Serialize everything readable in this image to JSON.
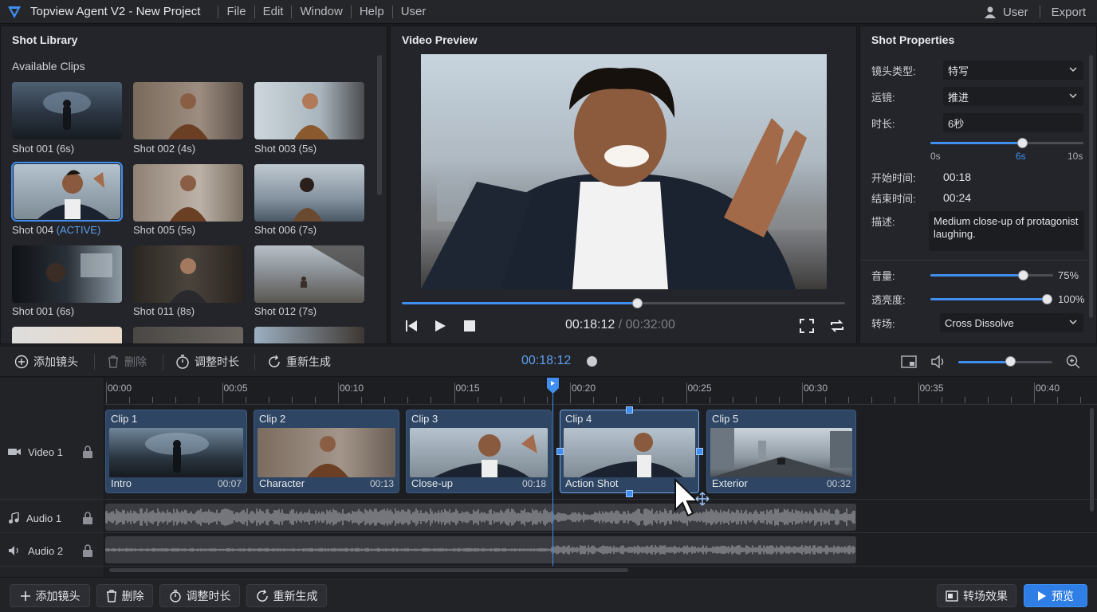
{
  "app": {
    "title": "Topview Agent V2 - New Project"
  },
  "menu": [
    "File",
    "Edit",
    "Window",
    "Help",
    "User"
  ],
  "menu_right": {
    "user": "User",
    "export": "Export"
  },
  "library": {
    "title": "Shot Library",
    "subtitle": "Available Clips",
    "clips": [
      {
        "name": "Shot 001 (6s)"
      },
      {
        "name": "Shot 002 (4s)"
      },
      {
        "name": "Shot 003 (5s)"
      },
      {
        "name": "Shot 004",
        "badge": "(ACTIVE)"
      },
      {
        "name": "Shot 005 (5s)"
      },
      {
        "name": "Shot 006 (7s)"
      },
      {
        "name": "Shot 001 (6s)"
      },
      {
        "name": "Shot 011 (8s)"
      },
      {
        "name": "Shot 012 (7s)"
      }
    ]
  },
  "preview": {
    "title": "Video Preview",
    "current": "00:18:12",
    "sep": "/",
    "total": "00:32:00",
    "progress": 0.53
  },
  "properties": {
    "title": "Shot Properties",
    "shot_type_label": "镜头类型:",
    "shot_type": "特写",
    "camera_label": "运镜:",
    "camera": "推进",
    "duration_label": "时长:",
    "duration": "6秒",
    "duration_min": "0s",
    "duration_val": "6s",
    "duration_max": "10s",
    "duration_fraction": 0.6,
    "start_label": "开始时间:",
    "start": "00:18",
    "end_label": "结束时间:",
    "end": "00:24",
    "desc_label": "描述:",
    "desc": "Medium close-up of protagonist laughing.",
    "volume_label": "音量:",
    "volume": "75%",
    "volume_fraction": 0.75,
    "opacity_label": "透亮度:",
    "opacity": "100%",
    "opacity_fraction": 1.0,
    "transition_label": "转场:",
    "transition": "Cross Dissolve"
  },
  "toolbar": {
    "add": "添加镜头",
    "delete": "删除",
    "adjust": "调整时长",
    "regen": "重新生成",
    "timecode": "00:18:12",
    "zoom_fraction": 0.55
  },
  "ruler": [
    "00:00",
    "00:05",
    "00:10",
    "00:15",
    "00:20",
    "00:25",
    "00:30",
    "00:35",
    "00:40"
  ],
  "tracks": {
    "video": "Video 1",
    "audio1": "Audio 1",
    "audio2": "Audio 2"
  },
  "clips": [
    {
      "name": "Clip 1",
      "desc": "Intro",
      "time": "00:07"
    },
    {
      "name": "Clip 2",
      "desc": "Character",
      "time": "00:13"
    },
    {
      "name": "Clip 3",
      "desc": "Close-up",
      "time": "00:18"
    },
    {
      "name": "Clip 4",
      "desc": "Action Shot",
      "time": ""
    },
    {
      "name": "Clip 5",
      "desc": "Exterior",
      "time": "00:32"
    }
  ],
  "bottom": {
    "add": "添加镜头",
    "delete": "删除",
    "adjust": "调整时长",
    "regen": "重新生成",
    "transition": "转场效果",
    "preview": "预览"
  },
  "colors": {
    "accent": "#3f8ef0",
    "clip": "#2e4664",
    "panel": "#24252a"
  }
}
